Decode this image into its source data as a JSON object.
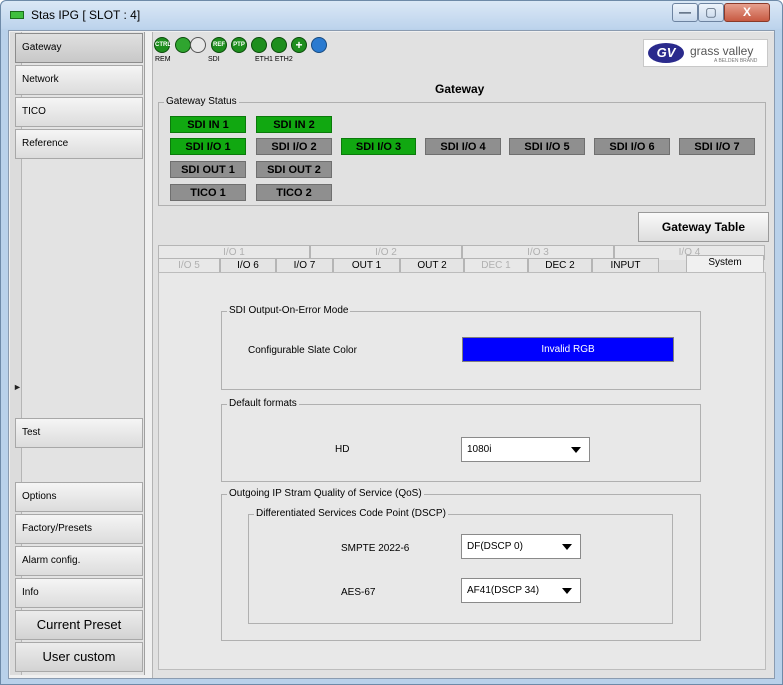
{
  "window": {
    "title": "Stas IPG [ SLOT : 4]",
    "min_symbol": "—",
    "max_symbol": "▢",
    "close_symbol": "X"
  },
  "sidebar": {
    "items": [
      {
        "label": "Gateway",
        "active": true
      },
      {
        "label": "Network"
      },
      {
        "label": "TICO"
      },
      {
        "label": "Reference"
      },
      {
        "label": "Test"
      },
      {
        "label": "Options"
      },
      {
        "label": "Factory/Presets"
      },
      {
        "label": "Alarm config."
      },
      {
        "label": "Info"
      }
    ],
    "current_preset_label": "Current Preset",
    "user_custom_label": "User custom"
  },
  "status_icons": {
    "icons": [
      {
        "name": "ctrl",
        "text": "CTRL"
      },
      {
        "name": "sdi-a",
        "text": ""
      },
      {
        "name": "sdi-b",
        "text": ""
      },
      {
        "name": "ref",
        "text": "REF"
      },
      {
        "name": "ptp",
        "text": "PTP"
      },
      {
        "name": "eth1",
        "text": ""
      },
      {
        "name": "eth2",
        "text": ""
      },
      {
        "name": "plus",
        "text": "+"
      },
      {
        "name": "refresh",
        "text": ""
      }
    ],
    "labels": {
      "rem": "REM",
      "sdi": "SDI",
      "eth": "ETH1 ETH2"
    }
  },
  "logo": {
    "text": "grass valley",
    "sub": "A BELDEN BRAND",
    "mark": "GV"
  },
  "gateway": {
    "title": "Gateway",
    "status_legend": "Gateway Status",
    "indicators": [
      {
        "label": "SDI IN 1",
        "state": "green"
      },
      {
        "label": "SDI IN 2",
        "state": "green"
      },
      {
        "label": "SDI I/O 1",
        "state": "green"
      },
      {
        "label": "SDI I/O 2",
        "state": "gray"
      },
      {
        "label": "SDI I/O 3",
        "state": "green"
      },
      {
        "label": "SDI I/O 4",
        "state": "gray"
      },
      {
        "label": "SDI I/O 5",
        "state": "gray"
      },
      {
        "label": "SDI I/O 6",
        "state": "gray"
      },
      {
        "label": "SDI I/O 7",
        "state": "gray"
      },
      {
        "label": "SDI OUT 1",
        "state": "gray"
      },
      {
        "label": "SDI OUT 2",
        "state": "gray"
      },
      {
        "label": "TICO 1",
        "state": "gray"
      },
      {
        "label": "TICO 2",
        "state": "gray"
      }
    ],
    "table_button": "Gateway Table"
  },
  "tabs": {
    "row1": [
      "I/O 1",
      "I/O 2",
      "I/O 3",
      "I/O 4"
    ],
    "row2": [
      "I/O 5",
      "I/O 6",
      "I/O 7",
      "OUT 1",
      "OUT 2",
      "DEC 1",
      "DEC 2",
      "INPUT",
      "System"
    ],
    "active": "System"
  },
  "system": {
    "sdi_error": {
      "legend": "SDI Output-On-Error Mode",
      "slate_label": "Configurable Slate Color",
      "slate_value": "Invalid RGB",
      "slate_color": "#0000ff"
    },
    "default_formats": {
      "legend": "Default formats",
      "hd_label": "HD",
      "hd_value": "1080i"
    },
    "qos": {
      "legend": "Outgoing IP Stram Quality of Service (QoS)",
      "dscp_legend": "Differentiated Services Code Point (DSCP)",
      "smpte_label": "SMPTE 2022-6",
      "smpte_value": "DF(DSCP 0)",
      "aes_label": "AES-67",
      "aes_value": "AF41(DSCP 34)"
    }
  }
}
